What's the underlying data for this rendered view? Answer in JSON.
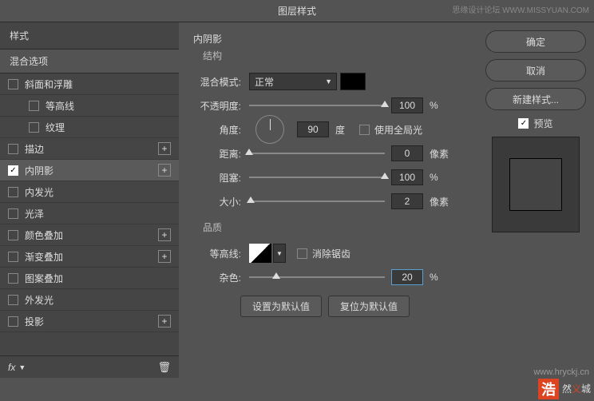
{
  "title": "图层样式",
  "watermark_top": "思缘设计论坛 WWW.MISSYUAN.COM",
  "left": {
    "header": "样式",
    "subheader": "混合选项",
    "items": [
      {
        "label": "斜面和浮雕",
        "checked": false,
        "add": false,
        "indent": 0
      },
      {
        "label": "等高线",
        "checked": false,
        "add": false,
        "indent": 1
      },
      {
        "label": "纹理",
        "checked": false,
        "add": false,
        "indent": 1
      },
      {
        "label": "描边",
        "checked": false,
        "add": true,
        "indent": 0
      },
      {
        "label": "内阴影",
        "checked": true,
        "add": true,
        "indent": 0,
        "selected": true
      },
      {
        "label": "内发光",
        "checked": false,
        "add": false,
        "indent": 0
      },
      {
        "label": "光泽",
        "checked": false,
        "add": false,
        "indent": 0
      },
      {
        "label": "颜色叠加",
        "checked": false,
        "add": true,
        "indent": 0
      },
      {
        "label": "渐变叠加",
        "checked": false,
        "add": true,
        "indent": 0
      },
      {
        "label": "图案叠加",
        "checked": false,
        "add": false,
        "indent": 0
      },
      {
        "label": "外发光",
        "checked": false,
        "add": false,
        "indent": 0
      },
      {
        "label": "投影",
        "checked": false,
        "add": true,
        "indent": 0
      }
    ]
  },
  "mid": {
    "section": "内阴影",
    "structure": "结构",
    "blend_label": "混合模式:",
    "blend_value": "正常",
    "opacity_label": "不透明度:",
    "opacity_value": "100",
    "pct": "%",
    "angle_label": "角度:",
    "angle_value": "90",
    "deg": "度",
    "global_light": "使用全局光",
    "distance_label": "距离:",
    "distance_value": "0",
    "px": "像素",
    "choke_label": "阻塞:",
    "choke_value": "100",
    "size_label": "大小:",
    "size_value": "2",
    "quality": "品质",
    "contour_label": "等高线:",
    "antialias": "消除锯齿",
    "noise_label": "杂色:",
    "noise_value": "20",
    "default_set": "设置为默认值",
    "default_reset": "复位为默认值"
  },
  "right": {
    "ok": "确定",
    "cancel": "取消",
    "new_style": "新建样式...",
    "preview": "预览"
  },
  "wm_url": "www.hryckj.cn",
  "wm_logo": "浩",
  "wm_text1": "然",
  "wm_text2": "义",
  "wm_text3": "城"
}
